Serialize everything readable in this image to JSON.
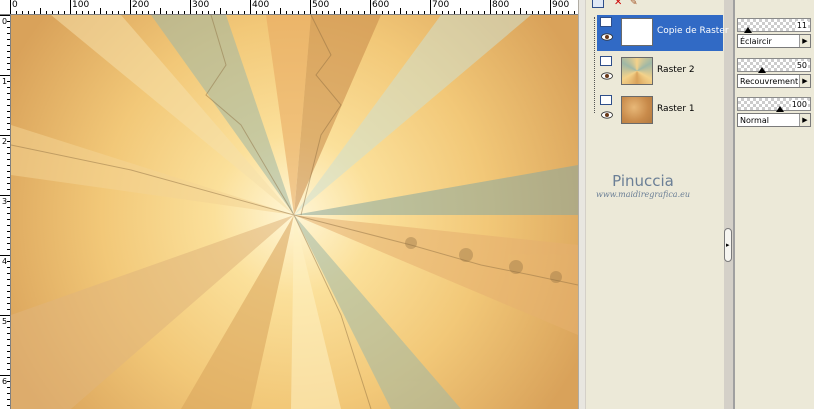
{
  "ruler": {
    "top_labels": [
      "0",
      "100",
      "200",
      "300",
      "400",
      "500",
      "600",
      "700",
      "800",
      "900"
    ],
    "left_labels": [
      "0",
      "1",
      "2",
      "3",
      "4",
      "5",
      "6",
      "7"
    ]
  },
  "layers": [
    {
      "name": "Copie de Raster",
      "selected": true,
      "thumb": "white"
    },
    {
      "name": "Raster 2",
      "selected": false,
      "thumb": "rays"
    },
    {
      "name": "Raster 1",
      "selected": false,
      "thumb": "texture"
    }
  ],
  "properties": [
    {
      "value": "11",
      "mode": "Éclaircir",
      "level": 0.11
    },
    {
      "value": "50",
      "mode": "Recouvrement",
      "level": 0.5
    },
    {
      "value": "100",
      "mode": "Normal",
      "level": 1.0
    }
  ],
  "watermark": {
    "title": "Pinuccia",
    "url": "www.maidiregrafica.eu"
  },
  "colors": {
    "accent": "#316ac5",
    "panel": "#ece9d8"
  }
}
